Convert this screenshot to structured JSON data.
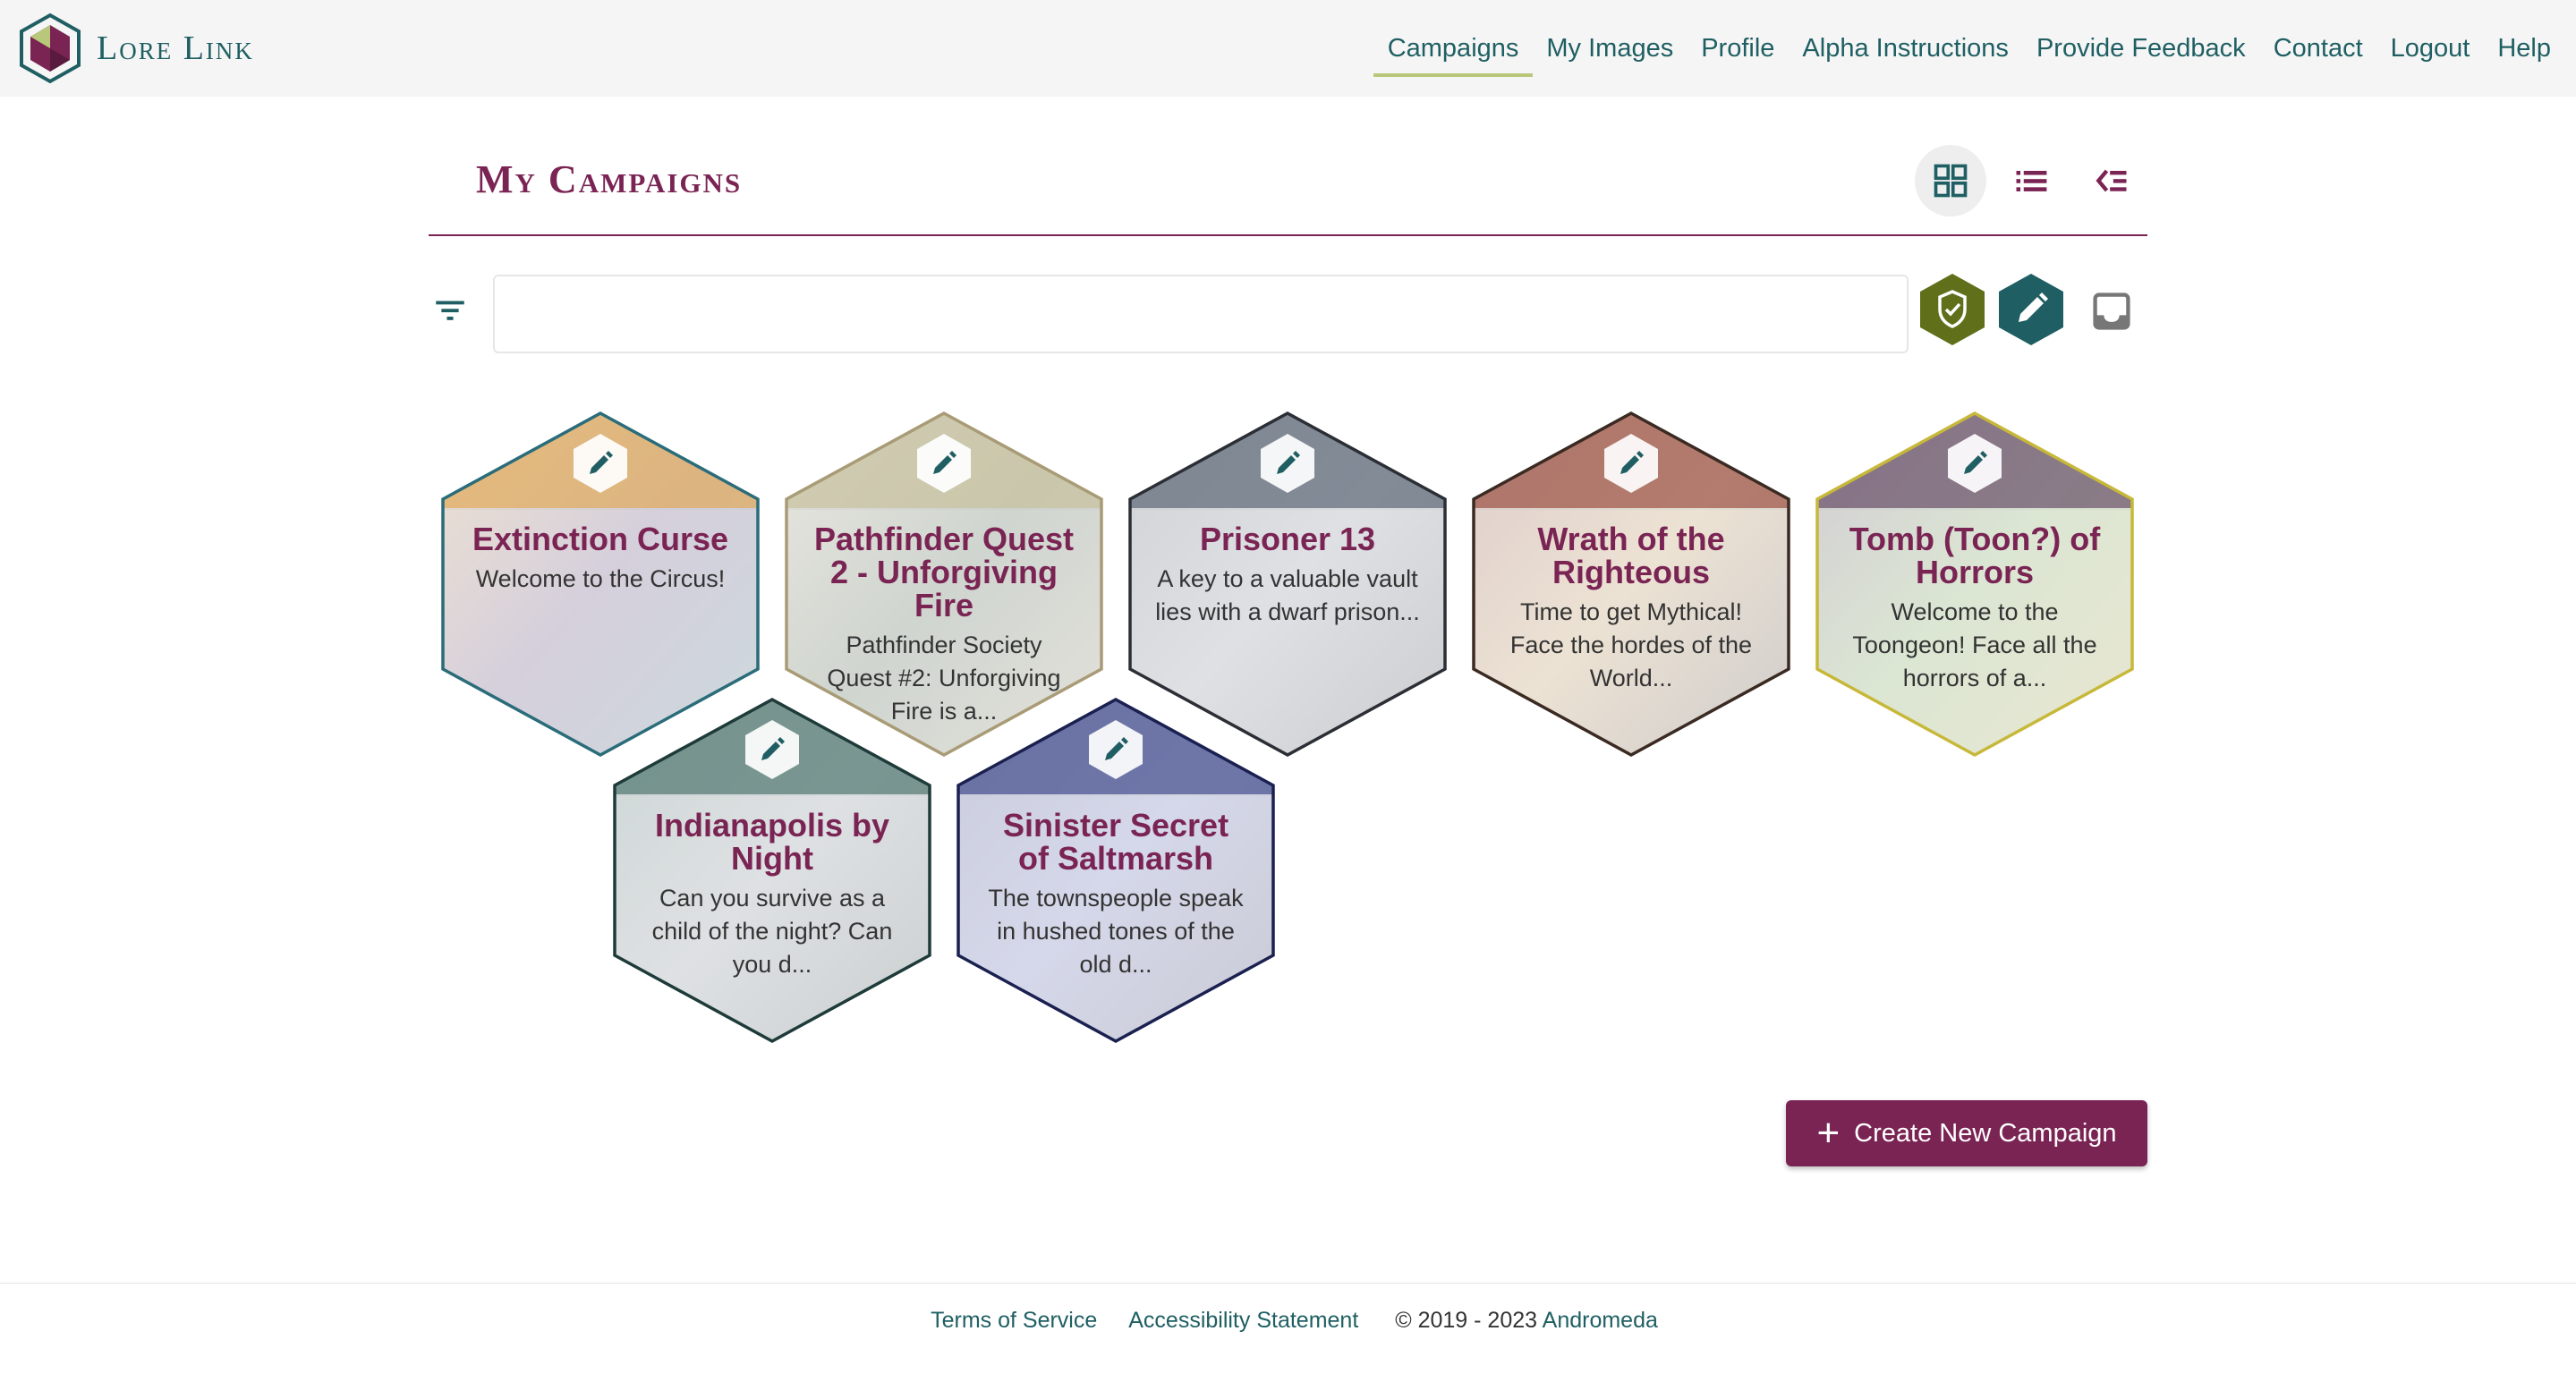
{
  "app": {
    "name": "Lore Link",
    "brand_color": "#7a2454",
    "accent_color": "#1f5f63"
  },
  "nav": {
    "items": [
      {
        "label": "Campaigns",
        "active": true
      },
      {
        "label": "My Images"
      },
      {
        "label": "Profile"
      },
      {
        "label": "Alpha Instructions"
      },
      {
        "label": "Provide Feedback"
      },
      {
        "label": "Contact"
      },
      {
        "label": "Logout"
      },
      {
        "label": "Help"
      }
    ]
  },
  "page": {
    "title": "My Campaigns",
    "view_modes": [
      {
        "icon": "grid-view-icon",
        "active": true
      },
      {
        "icon": "list-view-icon"
      },
      {
        "icon": "detail-list-icon"
      }
    ]
  },
  "search": {
    "value": "",
    "placeholder": "",
    "filters": [
      {
        "icon": "shield-check-icon",
        "color": "#5f6f1a"
      },
      {
        "icon": "pencil-icon",
        "color": "#1f5f63"
      },
      {
        "icon": "inbox-icon",
        "color": "#777777"
      }
    ]
  },
  "campaigns": [
    {
      "title": "Extinction Curse",
      "description": "Welcome to the Circus!",
      "colors": [
        "#e6a13a",
        "#5a3a7a",
        "#2a6c7a"
      ]
    },
    {
      "title": "Pathfinder Quest 2 - Unforgiving Fire",
      "description": "Pathfinder Society Quest #2: Unforgiving Fire is a...",
      "colors": [
        "#c7bd8f",
        "#3a5a33",
        "#a89b76"
      ]
    },
    {
      "title": "Prisoner 13",
      "description": "A key to a valuable vault lies with a dwarf prison...",
      "colors": [
        "#3d4a5c",
        "#8c97a3",
        "#2b2e35"
      ]
    },
    {
      "title": "Wrath of the Righteous",
      "description": "Time to get Mythical! Face the hordes of the World...",
      "colors": [
        "#8c2d1e",
        "#d7a14a",
        "#3a2a22"
      ]
    },
    {
      "title": "Tomb (Toon?) of Horrors",
      "description": "Welcome to the Toongeon! Face all the horrors of a...",
      "colors": [
        "#4a2a4a",
        "#7ab84a",
        "#c7b83a"
      ]
    },
    {
      "title": "Indianapolis by Night",
      "description": "Can you survive as a child of the night? Can you d...",
      "colors": [
        "#2d5e55",
        "#8c9aa0",
        "#1e3b3a"
      ]
    },
    {
      "title": "Sinister Secret of Saltmarsh",
      "description": "The townspeople speak in hushed tones of the old d...",
      "colors": [
        "#1e2a7a",
        "#5a6ac7",
        "#1a2050"
      ]
    }
  ],
  "create_button": {
    "label": "Create New Campaign"
  },
  "footer": {
    "terms": "Terms of Service",
    "accessibility": "Accessibility Statement",
    "copyright": "© 2019 - 2023",
    "company": "Andromeda"
  }
}
